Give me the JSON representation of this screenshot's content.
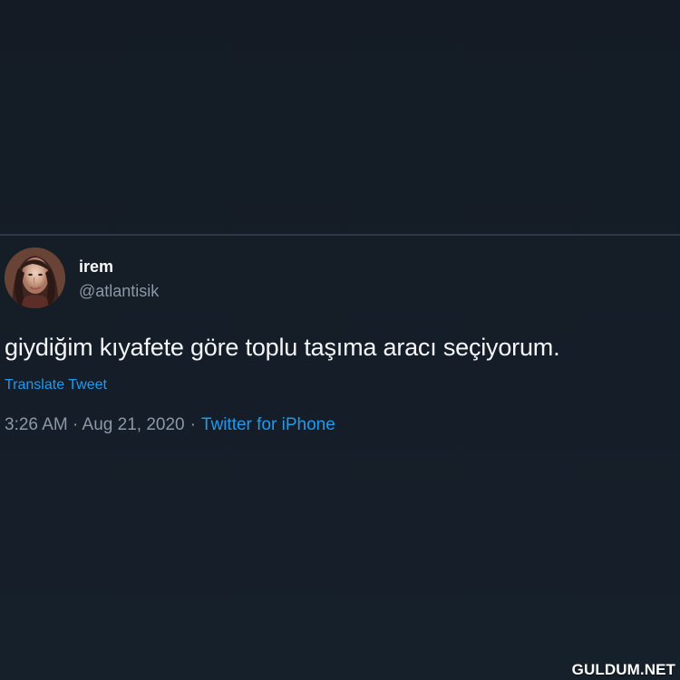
{
  "tweet": {
    "author": {
      "name": "irem",
      "handle": "@atlantisik"
    },
    "text": "giydiğim kıyafete göre toplu taşıma aracı seçiyorum.",
    "translate_label": "Translate Tweet",
    "timestamp": "3:26 AM · Aug 21, 2020",
    "separator": "·",
    "source": "Twitter for iPhone"
  },
  "watermark": {
    "text": "GULDUM.NET"
  },
  "colors": {
    "background": "#151c26",
    "primary_text": "#f4f6f8",
    "secondary_text": "#8b98a5",
    "link": "#1d9bf0",
    "divider": "#2d3946"
  },
  "icons": {
    "avatar": "profile-photo"
  }
}
